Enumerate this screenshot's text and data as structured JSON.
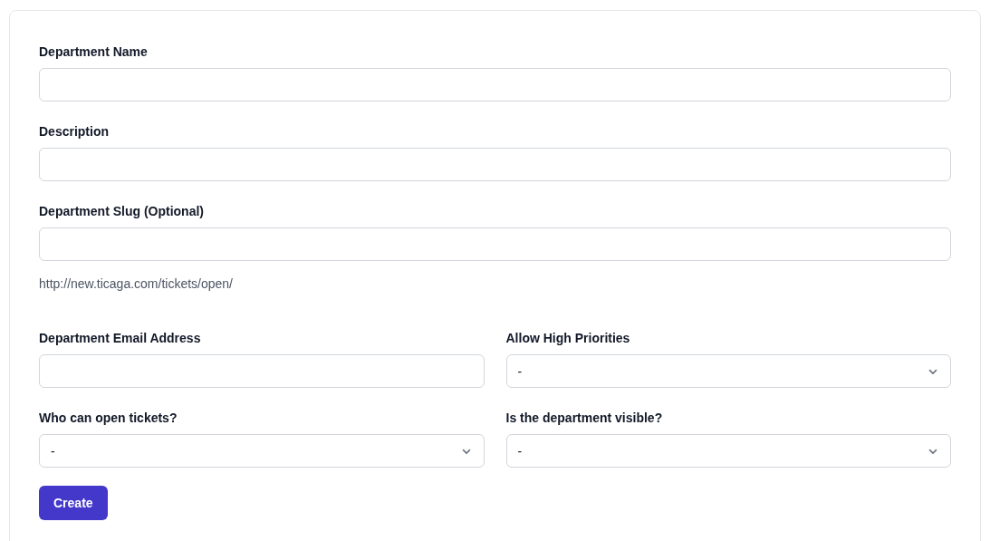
{
  "fields": [
    {
      "kind": "text",
      "label": "Department Name"
    },
    {
      "kind": "text",
      "label": "Description"
    },
    {
      "kind": "text",
      "label": "Department Slug (Optional)",
      "help": "http://new.ticaga.com/tickets/open/"
    }
  ],
  "grid_fields": [
    {
      "kind": "text",
      "label": "Department Email Address"
    },
    {
      "kind": "select",
      "label": "Allow High Priorities",
      "value": "-"
    },
    {
      "kind": "select",
      "label": "Who can open tickets?",
      "value": "-"
    },
    {
      "kind": "select",
      "label": "Is the department visible?",
      "value": "-"
    }
  ],
  "submit": "Create"
}
